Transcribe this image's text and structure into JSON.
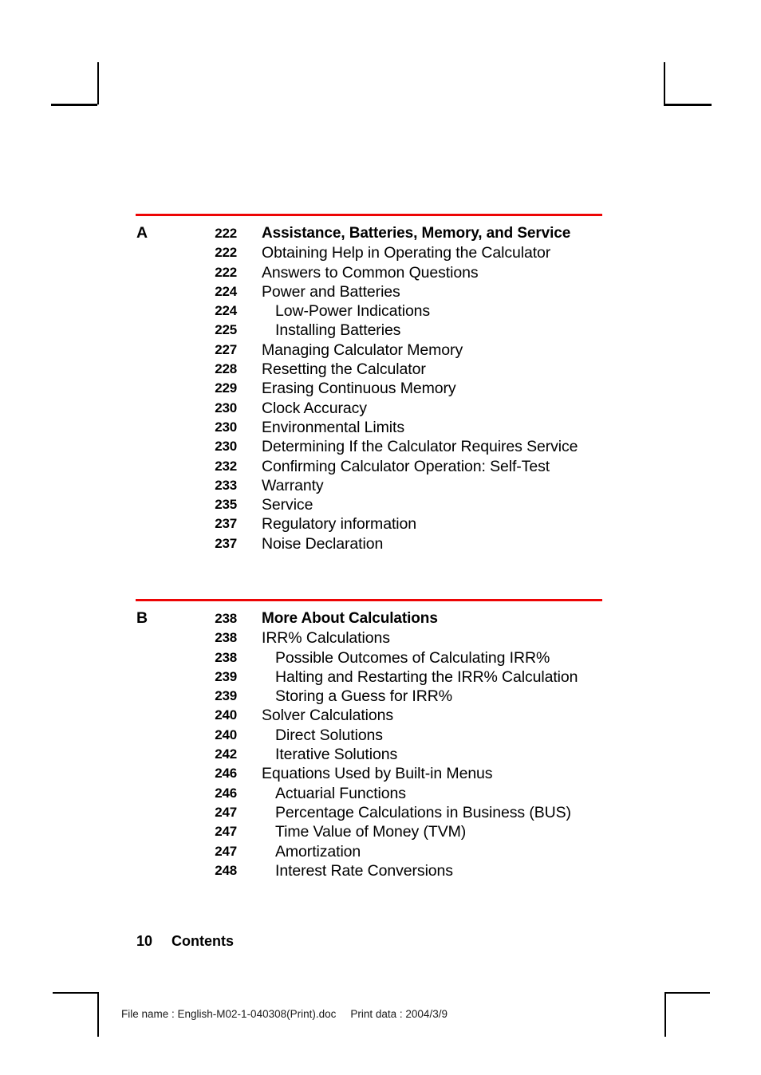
{
  "document": {
    "page_number": "10",
    "footer_label": "Contents"
  },
  "colors": {
    "rule_red": "#ED0505",
    "text_black": "#000000"
  },
  "print_stamp": {
    "file_name_label": "File name : English-M02-1-040308(Print).doc",
    "print_date_label": "Print data : 2004/3/9"
  },
  "sections": [
    {
      "letter": "A",
      "entries": [
        {
          "page": "222",
          "title": "Assistance, Batteries, Memory, and Service",
          "level": 0
        },
        {
          "page": "222",
          "title": "Obtaining Help in Operating the Calculator",
          "level": 1
        },
        {
          "page": "222",
          "title": "Answers to Common Questions",
          "level": 1
        },
        {
          "page": "224",
          "title": "Power and Batteries",
          "level": 1
        },
        {
          "page": "224",
          "title": "Low-Power Indications",
          "level": 2
        },
        {
          "page": "225",
          "title": "Installing Batteries",
          "level": 2
        },
        {
          "page": "227",
          "title": "Managing Calculator Memory",
          "level": 1
        },
        {
          "page": "228",
          "title": "Resetting the Calculator",
          "level": 1
        },
        {
          "page": "229",
          "title": "Erasing Continuous Memory",
          "level": 1
        },
        {
          "page": "230",
          "title": "Clock Accuracy",
          "level": 1
        },
        {
          "page": "230",
          "title": "Environmental Limits",
          "level": 1
        },
        {
          "page": "230",
          "title": "Determining If the Calculator Requires Service",
          "level": 1
        },
        {
          "page": "232",
          "title": "Confirming Calculator Operation: Self-Test",
          "level": 1
        },
        {
          "page": "233",
          "title": "Warranty",
          "level": 1
        },
        {
          "page": "235",
          "title": "Service",
          "level": 1
        },
        {
          "page": "237",
          "title": "Regulatory information",
          "level": 1
        },
        {
          "page": "237",
          "title": "Noise Declaration",
          "level": 1
        }
      ]
    },
    {
      "letter": "B",
      "entries": [
        {
          "page": "238",
          "title": "More About Calculations",
          "level": 0
        },
        {
          "page": "238",
          "title": "IRR% Calculations",
          "level": 1
        },
        {
          "page": "238",
          "title": "Possible Outcomes of Calculating IRR%",
          "level": 2
        },
        {
          "page": "239",
          "title": "Halting and Restarting the IRR% Calculation",
          "level": 2
        },
        {
          "page": "239",
          "title": "Storing a Guess for IRR%",
          "level": 2
        },
        {
          "page": "240",
          "title": "Solver Calculations",
          "level": 1
        },
        {
          "page": "240",
          "title": "Direct Solutions",
          "level": 2
        },
        {
          "page": "242",
          "title": "Iterative Solutions",
          "level": 2
        },
        {
          "page": "246",
          "title": "Equations Used by Built-in Menus",
          "level": 1
        },
        {
          "page": "246",
          "title": "Actuarial Functions",
          "level": 2
        },
        {
          "page": "247",
          "title": "Percentage Calculations in Business (BUS)",
          "level": 2
        },
        {
          "page": "247",
          "title": "Time Value of Money (TVM)",
          "level": 2
        },
        {
          "page": "247",
          "title": "Amortization",
          "level": 2
        },
        {
          "page": "248",
          "title": "Interest Rate Conversions",
          "level": 2
        }
      ]
    }
  ]
}
